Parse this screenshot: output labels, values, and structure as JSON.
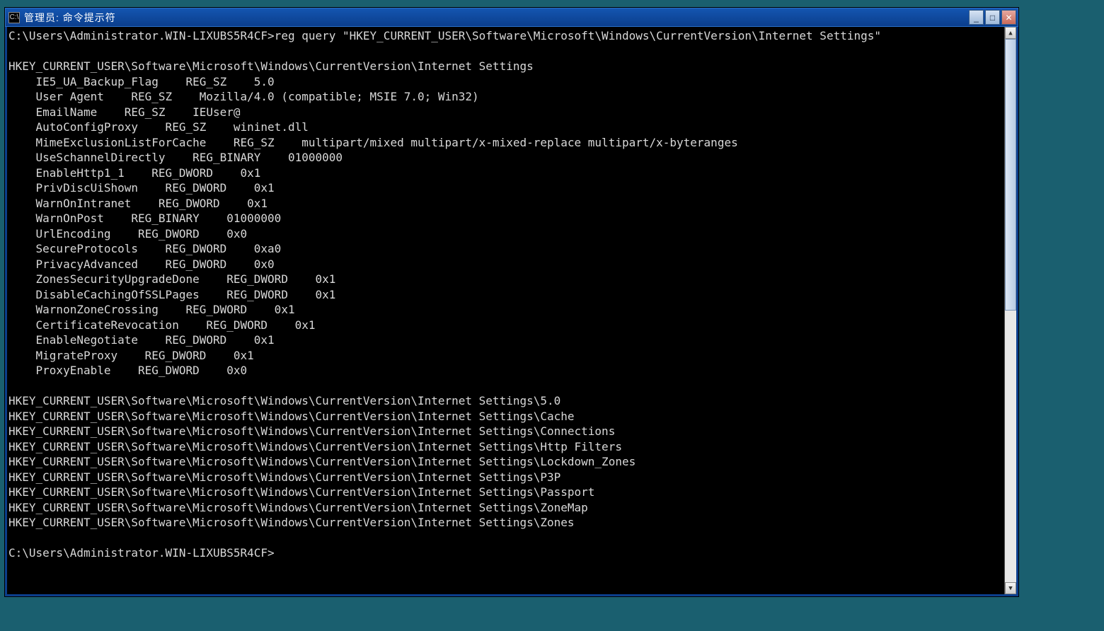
{
  "window": {
    "title": "管理员: 命令提示符",
    "icon_glyph": "C:\\"
  },
  "controls": {
    "minimize": "_",
    "maximize": "□",
    "close": "✕"
  },
  "scrollbar": {
    "up": "▲",
    "down": "▼"
  },
  "terminal": {
    "prompt1": "C:\\Users\\Administrator.WIN-LIXUBS5R4CF>",
    "command": "reg query \"HKEY_CURRENT_USER\\Software\\Microsoft\\Windows\\CurrentVersion\\Internet Settings\"",
    "blank1": "",
    "key_header": "HKEY_CURRENT_USER\\Software\\Microsoft\\Windows\\CurrentVersion\\Internet Settings",
    "values": [
      "    IE5_UA_Backup_Flag    REG_SZ    5.0",
      "    User Agent    REG_SZ    Mozilla/4.0 (compatible; MSIE 7.0; Win32)",
      "    EmailName    REG_SZ    IEUser@",
      "    AutoConfigProxy    REG_SZ    wininet.dll",
      "    MimeExclusionListForCache    REG_SZ    multipart/mixed multipart/x-mixed-replace multipart/x-byteranges",
      "    UseSchannelDirectly    REG_BINARY    01000000",
      "    EnableHttp1_1    REG_DWORD    0x1",
      "    PrivDiscUiShown    REG_DWORD    0x1",
      "    WarnOnIntranet    REG_DWORD    0x1",
      "    WarnOnPost    REG_BINARY    01000000",
      "    UrlEncoding    REG_DWORD    0x0",
      "    SecureProtocols    REG_DWORD    0xa0",
      "    PrivacyAdvanced    REG_DWORD    0x0",
      "    ZonesSecurityUpgradeDone    REG_DWORD    0x1",
      "    DisableCachingOfSSLPages    REG_DWORD    0x1",
      "    WarnonZoneCrossing    REG_DWORD    0x1",
      "    CertificateRevocation    REG_DWORD    0x1",
      "    EnableNegotiate    REG_DWORD    0x1",
      "    MigrateProxy    REG_DWORD    0x1",
      "    ProxyEnable    REG_DWORD    0x0"
    ],
    "blank2": "",
    "subkeys": [
      "HKEY_CURRENT_USER\\Software\\Microsoft\\Windows\\CurrentVersion\\Internet Settings\\5.0",
      "HKEY_CURRENT_USER\\Software\\Microsoft\\Windows\\CurrentVersion\\Internet Settings\\Cache",
      "HKEY_CURRENT_USER\\Software\\Microsoft\\Windows\\CurrentVersion\\Internet Settings\\Connections",
      "HKEY_CURRENT_USER\\Software\\Microsoft\\Windows\\CurrentVersion\\Internet Settings\\Http Filters",
      "HKEY_CURRENT_USER\\Software\\Microsoft\\Windows\\CurrentVersion\\Internet Settings\\Lockdown_Zones",
      "HKEY_CURRENT_USER\\Software\\Microsoft\\Windows\\CurrentVersion\\Internet Settings\\P3P",
      "HKEY_CURRENT_USER\\Software\\Microsoft\\Windows\\CurrentVersion\\Internet Settings\\Passport",
      "HKEY_CURRENT_USER\\Software\\Microsoft\\Windows\\CurrentVersion\\Internet Settings\\ZoneMap",
      "HKEY_CURRENT_USER\\Software\\Microsoft\\Windows\\CurrentVersion\\Internet Settings\\Zones"
    ],
    "blank3": "",
    "prompt2": "C:\\Users\\Administrator.WIN-LIXUBS5R4CF>"
  }
}
